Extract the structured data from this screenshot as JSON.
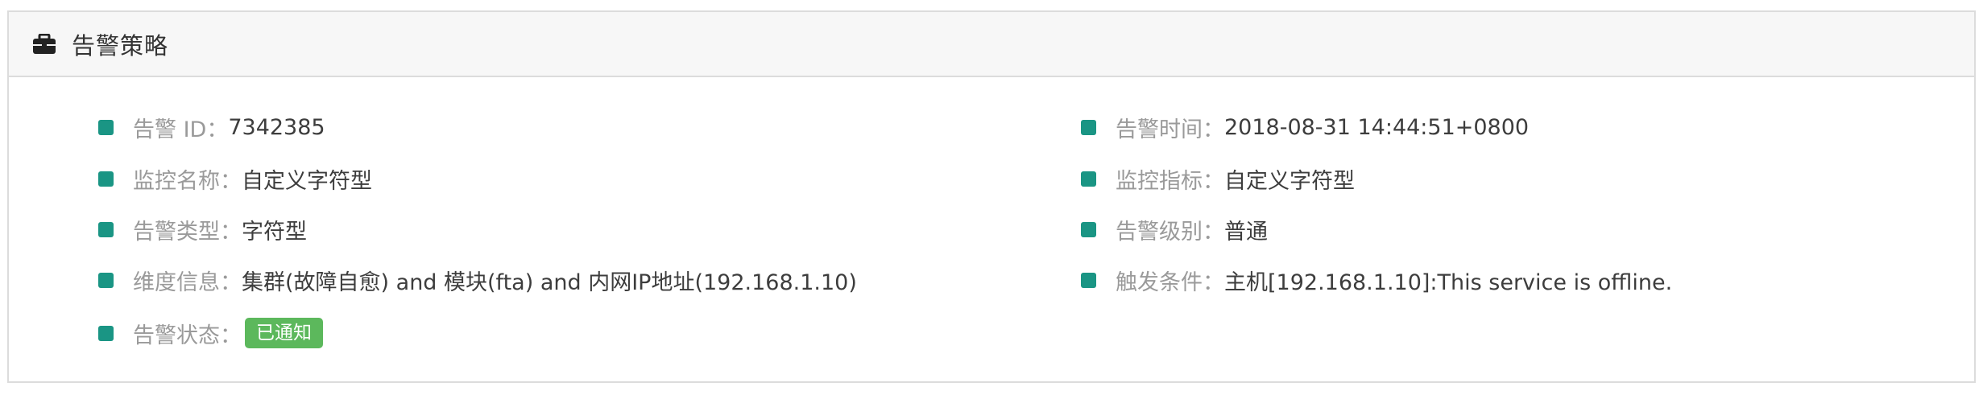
{
  "panel": {
    "title": "告警策略",
    "icon": "briefcase-icon"
  },
  "colors": {
    "bullet": "#1a9584",
    "badge_success": "#5cb85c",
    "label": "#9a9a9a",
    "value": "#3d3d3d"
  },
  "fields_left": [
    {
      "label": "告警 ID：",
      "value": "7342385"
    },
    {
      "label": "监控名称：",
      "value": "自定义字符型"
    },
    {
      "label": "告警类型：",
      "value": "字符型"
    },
    {
      "label": "维度信息：",
      "value": "集群(故障自愈) and 模块(fta) and 内网IP地址(192.168.1.10)"
    },
    {
      "label": "告警状态：",
      "value": "已通知"
    }
  ],
  "fields_right": [
    {
      "label": "告警时间：",
      "value": "2018-08-31 14:44:51+0800"
    },
    {
      "label": "监控指标：",
      "value": "自定义字符型"
    },
    {
      "label": "告警级别：",
      "value": "普通"
    },
    {
      "label": "触发条件：",
      "value": "主机[192.168.1.10]:This service is offline."
    }
  ]
}
